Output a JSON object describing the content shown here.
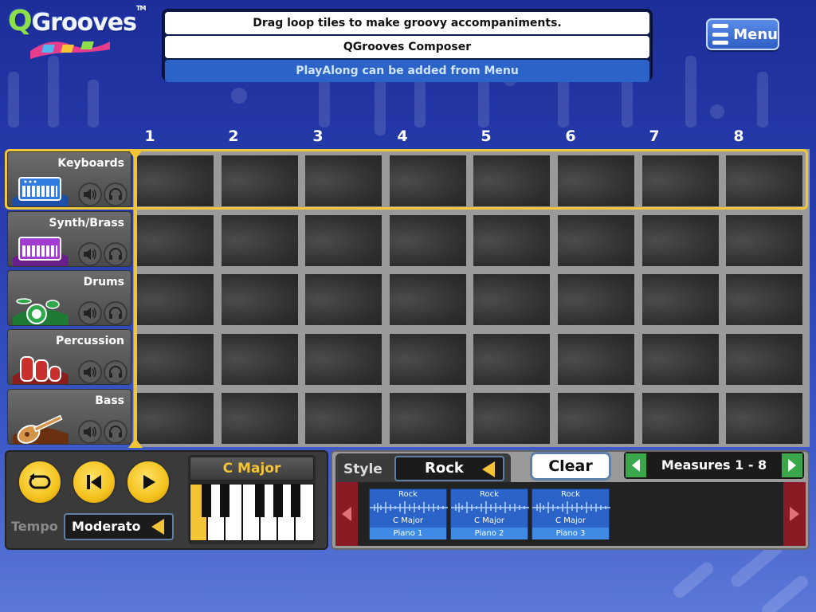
{
  "app": {
    "logo_text": "Grooves",
    "logo_q": "Q",
    "logo_tm": "TM"
  },
  "messages": {
    "line1": "Drag loop tiles to make groovy accompaniments.",
    "line2": "QGrooves Composer",
    "line3": "PlayAlong can be added from Menu"
  },
  "menu": {
    "label": "Menu"
  },
  "columns": [
    "1",
    "2",
    "3",
    "4",
    "5",
    "6",
    "7",
    "8"
  ],
  "tracks": [
    {
      "name": "Keyboards",
      "icon": "keyboard-icon",
      "color": "#2f7be0",
      "selected": true
    },
    {
      "name": "Synth/Brass",
      "icon": "synth-icon",
      "color": "#a23bd0"
    },
    {
      "name": "Drums",
      "icon": "drums-icon",
      "color": "#2fa84a"
    },
    {
      "name": "Percussion",
      "icon": "congas-icon",
      "color": "#c8302e"
    },
    {
      "name": "Bass",
      "icon": "bass-guitar-icon",
      "color": "#a85a22"
    }
  ],
  "transport": {
    "tempo_label": "Tempo",
    "tempo_value": "Moderato",
    "key_value": "C Major"
  },
  "loops": {
    "style_label": "Style",
    "style_value": "Rock",
    "clear_label": "Clear",
    "measures_label": "Measures 1 - 8",
    "tiles": [
      {
        "style": "Rock",
        "key": "C Major",
        "name": "Piano 1"
      },
      {
        "style": "Rock",
        "key": "C Major",
        "name": "Piano 2"
      },
      {
        "style": "Rock",
        "key": "C Major",
        "name": "Piano 3"
      }
    ]
  },
  "colors": {
    "accent_yellow": "#f4c437",
    "panel_blue": "#2b63c8",
    "arrow_green": "#3aa84a",
    "arrow_red": "#8a1a24"
  }
}
